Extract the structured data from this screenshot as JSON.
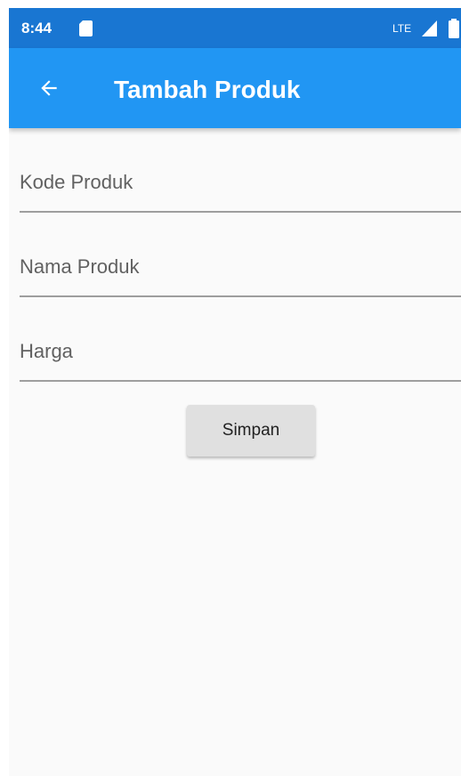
{
  "status_bar": {
    "time": "8:44",
    "network": "LTE",
    "sd_icon": "sd-card-icon",
    "signal_icon": "signal-icon",
    "battery_icon": "battery-icon"
  },
  "app_bar": {
    "title": "Tambah Produk",
    "back_icon": "arrow-back-icon",
    "background_color": "#2196f3",
    "status_color": "#1976d2"
  },
  "form": {
    "fields": [
      {
        "placeholder": "Kode Produk",
        "value": ""
      },
      {
        "placeholder": "Nama Produk",
        "value": ""
      },
      {
        "placeholder": "Harga",
        "value": ""
      }
    ],
    "submit_label": "Simpan"
  }
}
